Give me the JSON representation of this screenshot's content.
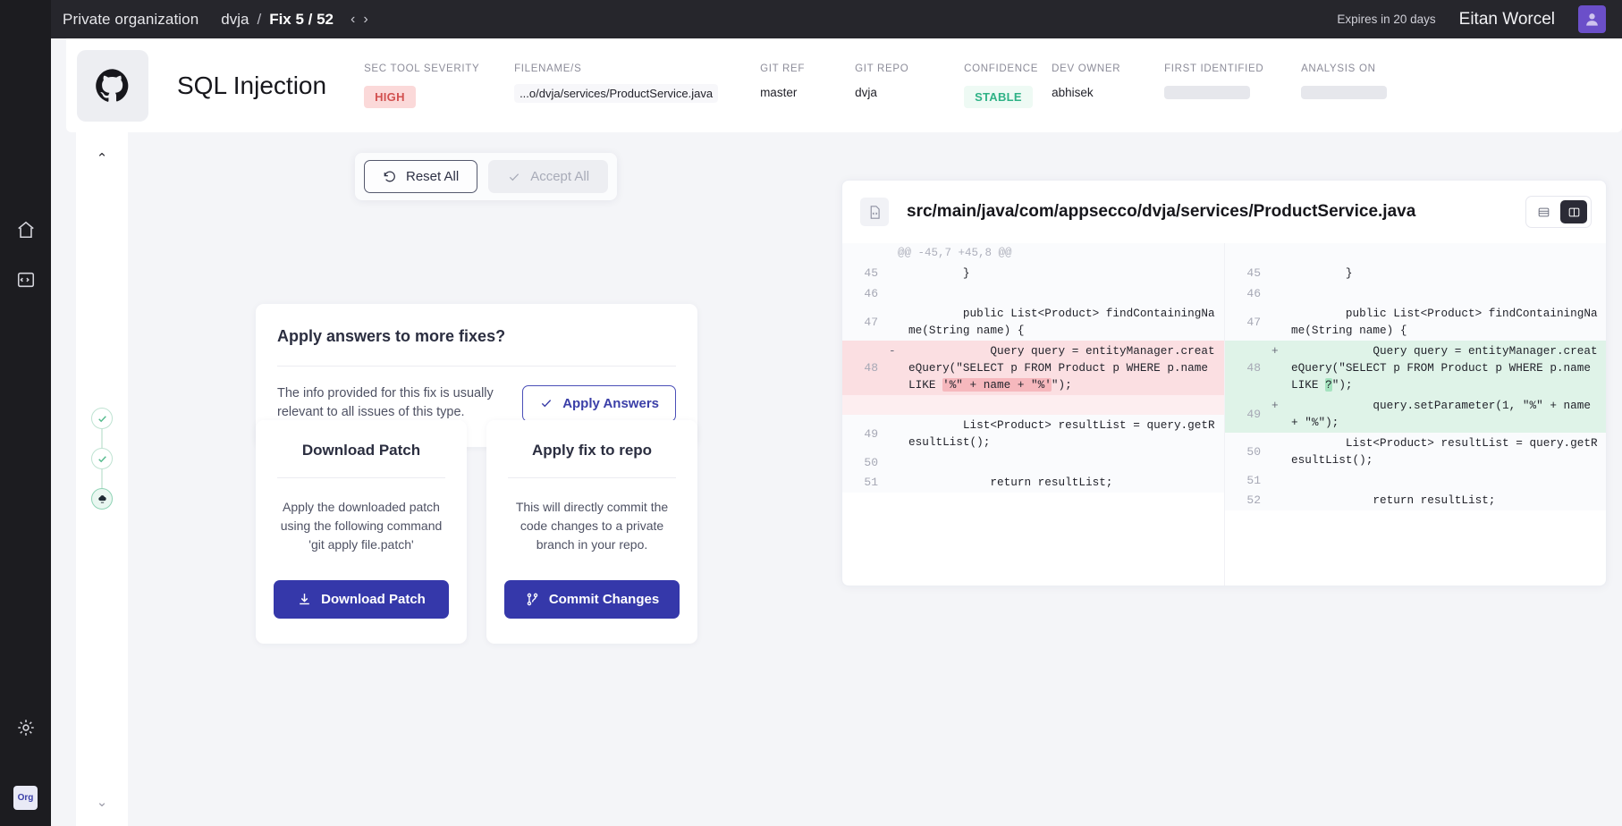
{
  "topbar": {
    "org": "Private organization",
    "repo": "dvja",
    "separator": "/",
    "fix_counter": "Fix 5 / 52",
    "prev_arrow": "‹",
    "next_arrow": "›",
    "expires": "Expires in 20 days",
    "user": "Eitan Worcel"
  },
  "rail": {
    "org_chip": "Org"
  },
  "finding": {
    "title": "SQL Injection",
    "meta": [
      {
        "label": "SEC TOOL SEVERITY",
        "value": "HIGH",
        "type": "pill-high"
      },
      {
        "label": "FILENAME/S",
        "value": "...o/dvja/services/ProductService.java",
        "type": "file"
      },
      {
        "label": "GIT REF",
        "value": "master",
        "type": "text"
      },
      {
        "label": "GIT REPO",
        "value": "dvja",
        "type": "text"
      },
      {
        "label": "CONFIDENCE",
        "value": "STABLE",
        "type": "pill-stable"
      },
      {
        "label": "DEV OWNER",
        "value": "abhisek",
        "type": "text"
      },
      {
        "label": "FIRST IDENTIFIED",
        "value": "",
        "type": "skeleton"
      },
      {
        "label": "ANALYSIS ON",
        "value": "",
        "type": "skeleton"
      }
    ]
  },
  "actions": {
    "reset_all": "Reset All",
    "accept_all": "Accept All"
  },
  "apply_card": {
    "title": "Apply answers to more fixes?",
    "body": "The info provided for this fix is usually relevant to all issues of this type.",
    "button": "Apply Answers"
  },
  "patch_card": {
    "title": "Download Patch",
    "body": "Apply the downloaded patch using the following command 'git apply file.patch'",
    "button": "Download Patch"
  },
  "repo_card": {
    "title": "Apply fix to repo",
    "body": "This will directly commit the code changes to a private branch in your repo.",
    "button": "Commit Changes"
  },
  "diff": {
    "filename": "src/main/java/com/appsecco/dvja/services/ProductService.java",
    "view_unified_label": "unified-view",
    "view_split_label": "split-view",
    "active_view": "split",
    "hunk": "@@ -45,7 +45,8 @@",
    "left": [
      {
        "num": "45",
        "mark": "",
        "code": "        }",
        "kind": "ctx"
      },
      {
        "num": "46",
        "mark": "",
        "code": "",
        "kind": "blank"
      },
      {
        "num": "47",
        "mark": "",
        "code": "        public List<Product> findContainingName(String name) {",
        "kind": "ctx"
      },
      {
        "num": "48",
        "mark": "-",
        "code": "            Query query = entityManager.createQuery(\"SELECT p FROM Product p WHERE p.name LIKE ",
        "code2": "'%\" + name + \"%'",
        "code3": "\");",
        "kind": "del"
      },
      {
        "num": "",
        "mark": "",
        "code": "",
        "kind": "gap-del"
      },
      {
        "num": "49",
        "mark": "",
        "code": "        List<Product> resultList = query.getResultList();",
        "kind": "ctx"
      },
      {
        "num": "50",
        "mark": "",
        "code": "",
        "kind": "blank"
      },
      {
        "num": "51",
        "mark": "",
        "code": "            return resultList;",
        "kind": "ctx"
      }
    ],
    "right": [
      {
        "num": "45",
        "mark": "",
        "code": "        }",
        "kind": "ctx"
      },
      {
        "num": "46",
        "mark": "",
        "code": "",
        "kind": "blank"
      },
      {
        "num": "47",
        "mark": "",
        "code": "        public List<Product> findContainingName(String name) {",
        "kind": "ctx"
      },
      {
        "num": "48",
        "mark": "+",
        "code": "            Query query = entityManager.createQuery(\"SELECT p FROM Product p WHERE p.name LIKE ",
        "code2": "?",
        "code3": "\");",
        "kind": "add"
      },
      {
        "num": "49",
        "mark": "+",
        "code": "            query.setParameter(1, \"%\" + name + \"%\");",
        "kind": "add"
      },
      {
        "num": "50",
        "mark": "",
        "code": "        List<Product> resultList = query.getResultList();",
        "kind": "ctx"
      },
      {
        "num": "51",
        "mark": "",
        "code": "",
        "kind": "blank"
      },
      {
        "num": "52",
        "mark": "",
        "code": "            return resultList;",
        "kind": "ctx"
      }
    ]
  }
}
